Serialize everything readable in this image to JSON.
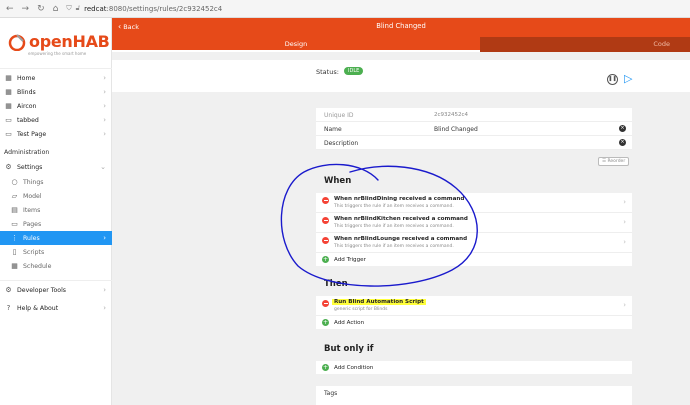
{
  "browser": {
    "url_host": "redcat",
    "url_path": ":8080/settings/rules/2c932452c4"
  },
  "sidebar": {
    "logo_text": "openHAB",
    "logo_sub": "empowering the smart home",
    "items": [
      {
        "label": "Home",
        "icon": "grid-icon"
      },
      {
        "label": "Blinds",
        "icon": "grid-icon"
      },
      {
        "label": "Aircon",
        "icon": "grid-icon"
      },
      {
        "label": "tabbed",
        "icon": "tab-icon"
      },
      {
        "label": "Test Page",
        "icon": "tab-icon"
      }
    ],
    "admin_heading": "Administration",
    "settings_label": "Settings",
    "settings_children": [
      "Things",
      "Model",
      "Items",
      "Pages",
      "Rules",
      "Scripts",
      "Schedule"
    ],
    "dev_tools": "Developer Tools",
    "help": "Help & About"
  },
  "header": {
    "back_label": "Back",
    "title": "Blind Changed",
    "tab_design": "Design",
    "tab_code": "Code"
  },
  "status": {
    "label": "Status:",
    "badge": "IDLE",
    "badge_color": "#4caf50"
  },
  "info": {
    "uid_label": "Unique ID",
    "uid_value": "2c932452c4",
    "name_label": "Name",
    "name_value": "Blind Changed",
    "desc_label": "Description",
    "desc_value": ""
  },
  "reorder_label": "Reorder",
  "when": {
    "title": "When",
    "triggers": [
      {
        "title": "When nrBlindDining received a command",
        "desc": "This triggers the rule if an item receives a command."
      },
      {
        "title": "When nrBlindKitchen received a command",
        "desc": "This triggers the rule if an item receives a command."
      },
      {
        "title": "When nrBlindLounge received a command",
        "desc": "This triggers the rule if an item receives a command."
      }
    ],
    "add_label": "Add Trigger"
  },
  "then": {
    "title": "Then",
    "actions": [
      {
        "title": "Run Blind Automation Script",
        "desc": "generic script for Blinds"
      }
    ],
    "add_label": "Add Action"
  },
  "only_if": {
    "title": "But only if",
    "add_label": "Add Condition"
  },
  "tags_label": "Tags",
  "colors": {
    "brand": "#e64a19",
    "accent": "#2196f3",
    "highlight": "#ffff3b",
    "annotation": "#1a1acc"
  }
}
